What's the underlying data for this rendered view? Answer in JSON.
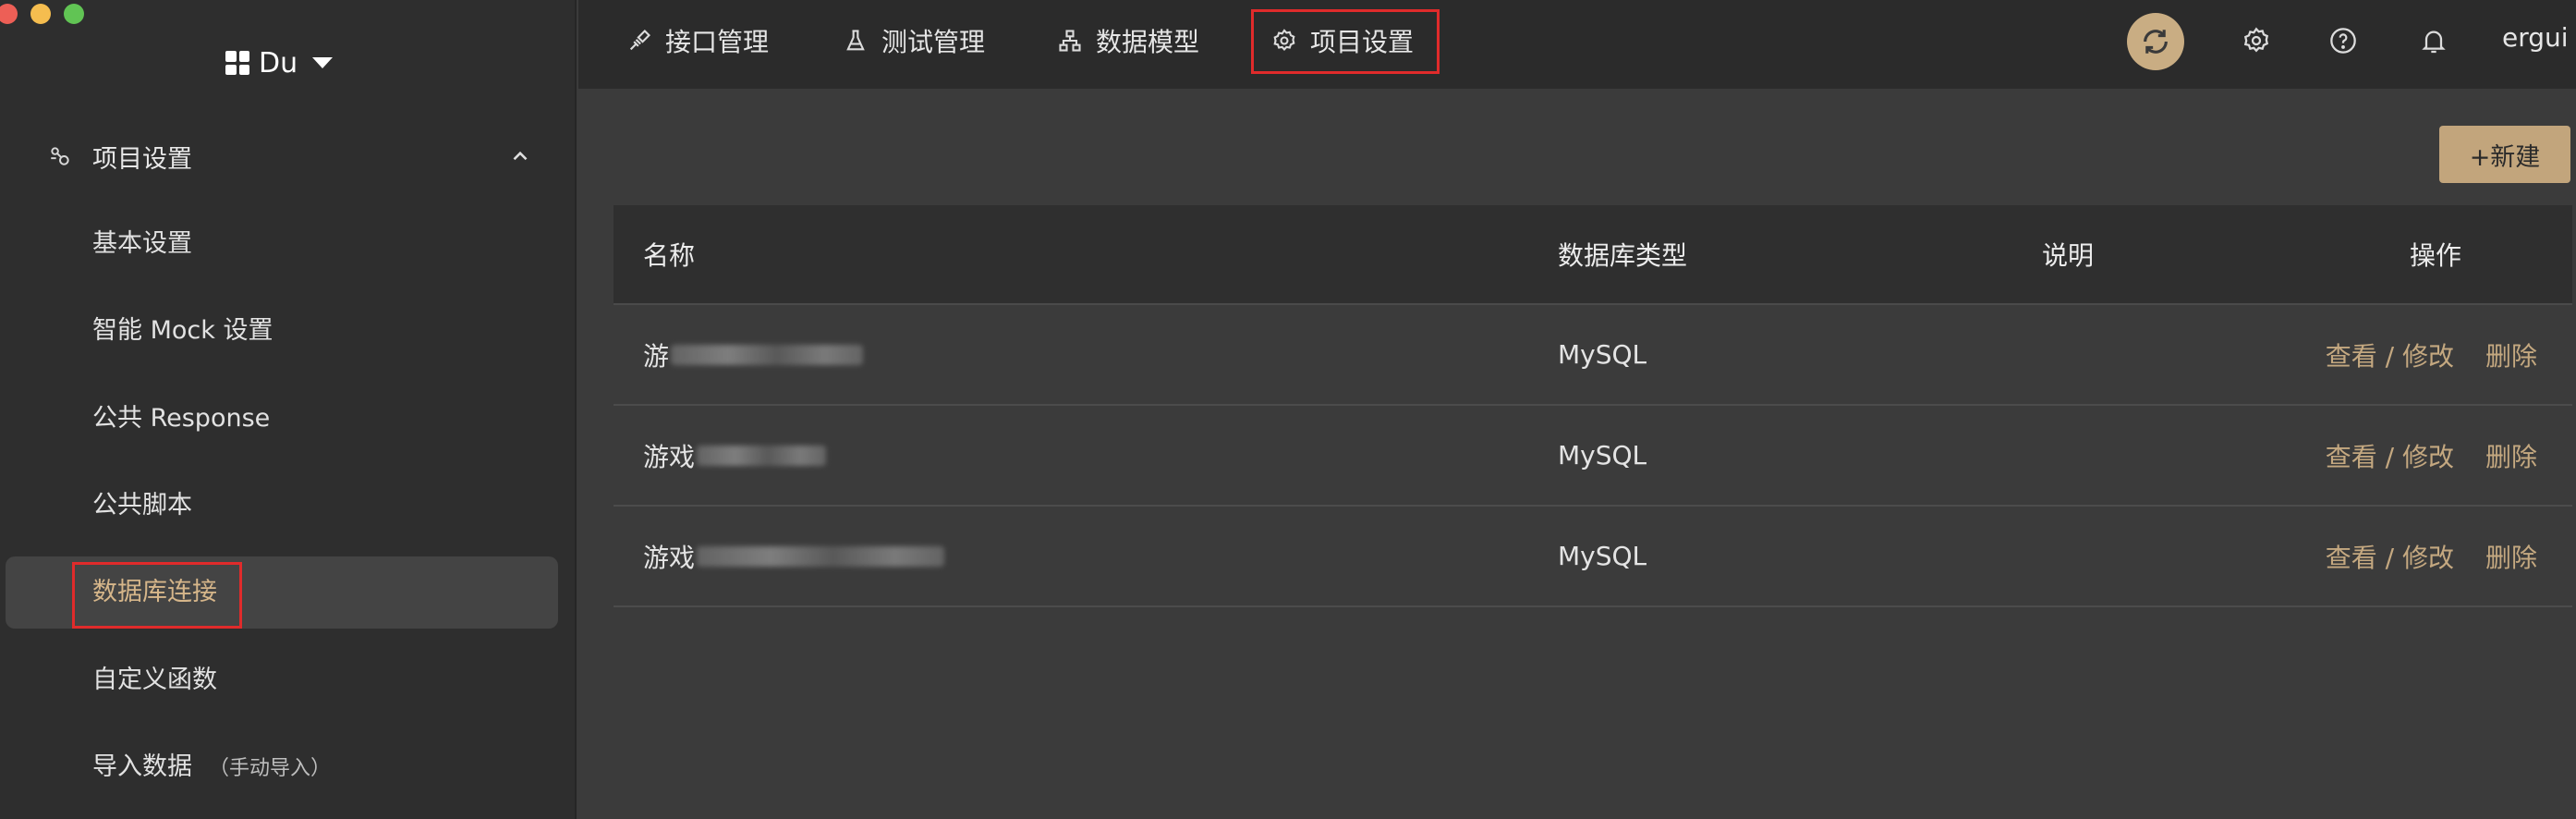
{
  "workspace": {
    "name": "Du"
  },
  "sidebar": {
    "section_title": "项目设置",
    "items": [
      {
        "label": "基本设置"
      },
      {
        "label": "智能 Mock 设置"
      },
      {
        "label": "公共 Response"
      },
      {
        "label": "公共脚本"
      },
      {
        "label": "数据库连接",
        "active": true
      },
      {
        "label": "自定义函数"
      },
      {
        "label": "导入数据",
        "sub": "（手动导入）"
      }
    ]
  },
  "topbar": {
    "tabs": [
      {
        "label": "接口管理",
        "icon": "api-icon"
      },
      {
        "label": "测试管理",
        "icon": "flask-icon"
      },
      {
        "label": "数据模型",
        "icon": "data-model-icon"
      },
      {
        "label": "项目设置",
        "icon": "gear-icon",
        "active": true
      }
    ],
    "username": "ergui"
  },
  "main": {
    "new_button": "+新建",
    "columns": [
      "名称",
      "数据库类型",
      "说明",
      "操作"
    ],
    "rows": [
      {
        "name": "游",
        "type": "MySQL",
        "desc": "",
        "edit": "查看 / 修改",
        "delete": "删除"
      },
      {
        "name": "游戏",
        "type": "MySQL",
        "desc": "",
        "edit": "查看 / 修改",
        "delete": "删除"
      },
      {
        "name": "游戏",
        "type": "MySQL",
        "desc": "",
        "edit": "查看 / 修改",
        "delete": "删除"
      }
    ]
  },
  "colors": {
    "accent": "#c9ad83",
    "link": "#c4a880",
    "highlight_box": "#e02b2b",
    "sidebar_bg": "#2e2e2e",
    "main_bg": "#3b3b3b"
  }
}
